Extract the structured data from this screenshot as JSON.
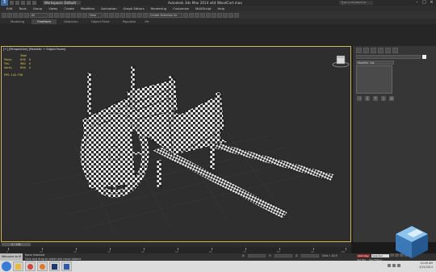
{
  "titlebar": {
    "workspace": "Workspace: Default",
    "title": "Autodesk 3ds Max  2014 x64     WoodCart.max",
    "search_placeholder": "Type a keyword or phrase"
  },
  "menu": [
    "Edit",
    "Tools",
    "Group",
    "Views",
    "Create",
    "Modifiers",
    "Animation",
    "Graph Editors",
    "Rendering",
    "Customize",
    "MAXScript",
    "Help"
  ],
  "ribbon": {
    "tabs": [
      "Modeling",
      "Freeform",
      "Selection",
      "Object Paint",
      "Populate"
    ],
    "active": 1
  },
  "toolbar": {
    "filter": "All",
    "view": "View",
    "selection_set": "Create Selection Se"
  },
  "viewport": {
    "label": "[+] [Perspective] [Realistic + Edged Faces]",
    "stats": {
      "header": "Total",
      "rows": [
        {
          "k": "Polys:",
          "v": "836",
          "v2": "0"
        },
        {
          "k": "Tris:",
          "v": "980",
          "v2": "0"
        },
        {
          "k": "Verts:",
          "v": "656",
          "v2": "0"
        }
      ]
    },
    "fps": "FPS:      142.796"
  },
  "command_panel": {
    "modifier_list": "Modifier List"
  },
  "timeslider": {
    "thumb": "0 / 100",
    "ticks": [
      "0",
      "10",
      "20",
      "30",
      "40",
      "50",
      "60",
      "70",
      "80",
      "90",
      "100"
    ]
  },
  "status": {
    "welcome": "Welcome to M",
    "line1": "None Selected",
    "line2": "Click and drag to select and move objects",
    "x": "X:",
    "y": "Y:",
    "z": "Z:",
    "grid": "Grid = 10.0",
    "auto_key": "Auto Key",
    "selected": "Selected",
    "set_key": "Set Key",
    "key_filters": "Key Filters...",
    "add_time_tag": "Add Time Tag"
  },
  "taskbar": {
    "clock_time": "10:48 AM",
    "clock_date": "4/15/2014",
    "apps": [
      "explorer",
      "chrome",
      "firefox",
      "photoshop",
      "word"
    ]
  },
  "colors": {
    "accent": "#d4b850",
    "auto_key": "#9a2a2a",
    "checker_dark": "#2a2a2a",
    "checker_light": "#e6e6e6"
  }
}
